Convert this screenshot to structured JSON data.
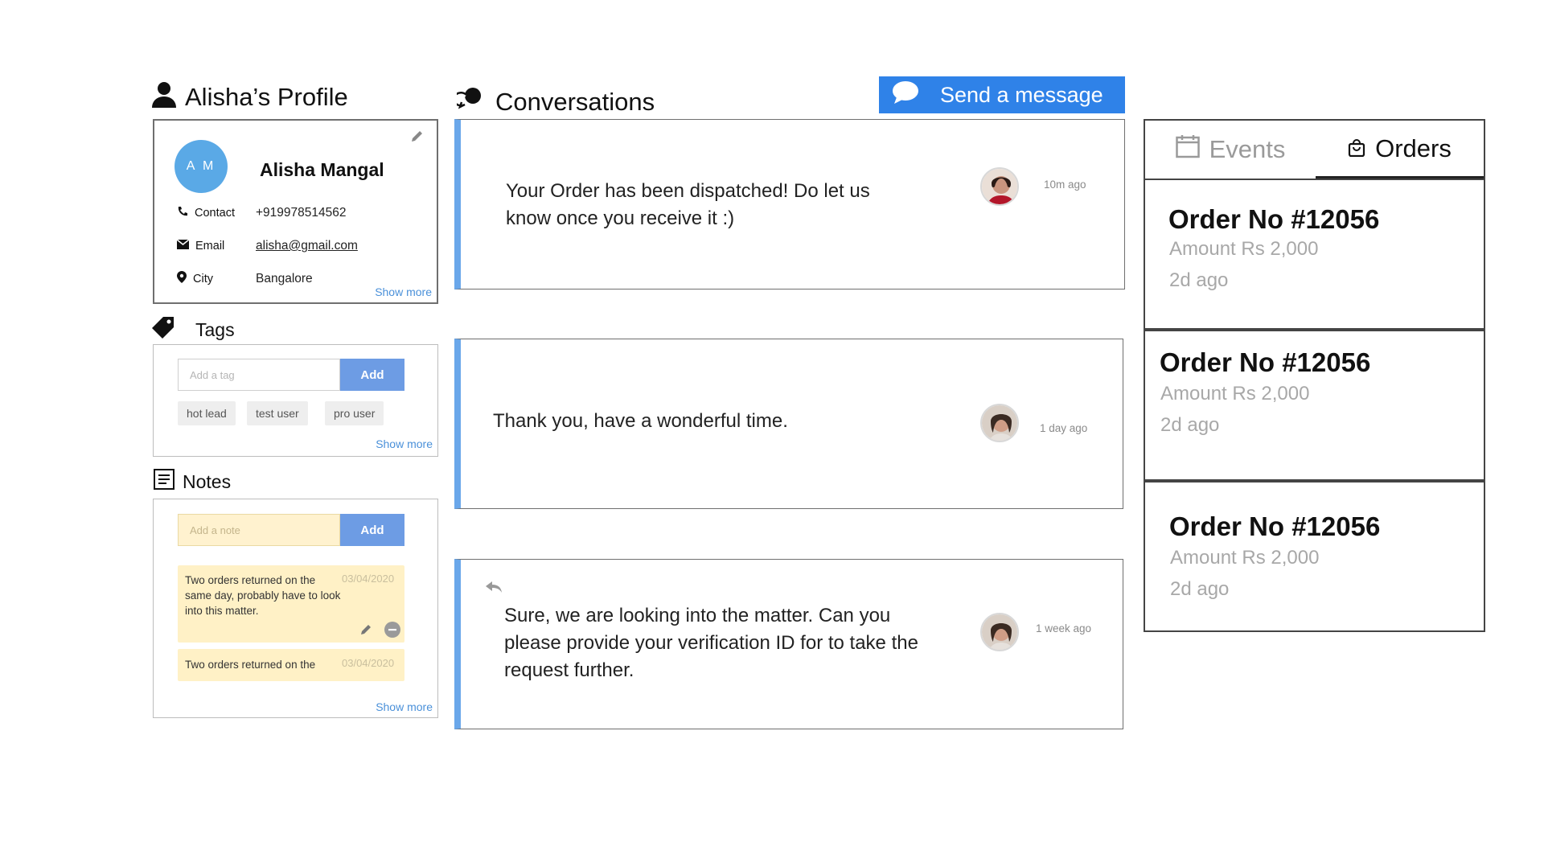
{
  "profile": {
    "heading": "Alisha’s Profile",
    "initials": "A M",
    "name": "Alisha Mangal",
    "rows": [
      {
        "label": "Contact",
        "value": "+919978514562",
        "icon": "phone-icon"
      },
      {
        "label": "Email",
        "value": "alisha@gmail.com",
        "icon": "envelope-icon"
      },
      {
        "label": "City",
        "value": "Bangalore",
        "icon": "location-pin-icon"
      }
    ],
    "show_more": "Show more"
  },
  "tags": {
    "heading": "Tags",
    "placeholder": "Add a tag",
    "add_label": "Add",
    "items": [
      "hot lead",
      "test user",
      "pro user"
    ],
    "show_more": "Show more"
  },
  "notes": {
    "heading": "Notes",
    "placeholder": "Add a note",
    "add_label": "Add",
    "items": [
      {
        "text": "Two orders returned on the same day, probably have to look into this matter.",
        "date": "03/04/2020"
      },
      {
        "text": "Two orders returned on the",
        "date": "03/04/2020"
      }
    ],
    "show_more": "Show more"
  },
  "conversations": {
    "heading": "Conversations",
    "send_label": "Send a message",
    "items": [
      {
        "text": "Your Order has been dispatched! Do let us know once you receive it :)",
        "time": "10m ago"
      },
      {
        "text": "Thank you, have a wonderful time.",
        "time": "1 day ago"
      },
      {
        "text": "Sure, we are looking into the matter. Can you please provide your verification ID for to take the request further.",
        "time": "1 week ago"
      }
    ]
  },
  "orders_panel": {
    "tabs": [
      {
        "label": "Events",
        "icon": "calendar-icon",
        "active": false
      },
      {
        "label": "Orders",
        "icon": "shopping-bag-icon",
        "active": true
      }
    ],
    "orders": [
      {
        "title": "Order No #12056",
        "amount": "Amount Rs 2,000",
        "time": "2d ago"
      },
      {
        "title": "Order No #12056",
        "amount": "Amount Rs 2,000",
        "time": "2d ago"
      },
      {
        "title": "Order No #12056",
        "amount": "Amount Rs 2,000",
        "time": "2d ago"
      }
    ]
  },
  "colors": {
    "accent_blue": "#2f82e8",
    "avatar_blue": "#5aa9e6",
    "add_button": "#6d9ce4",
    "note_yellow": "#fff1c6",
    "conversation_bar": "#6aa7ea"
  }
}
